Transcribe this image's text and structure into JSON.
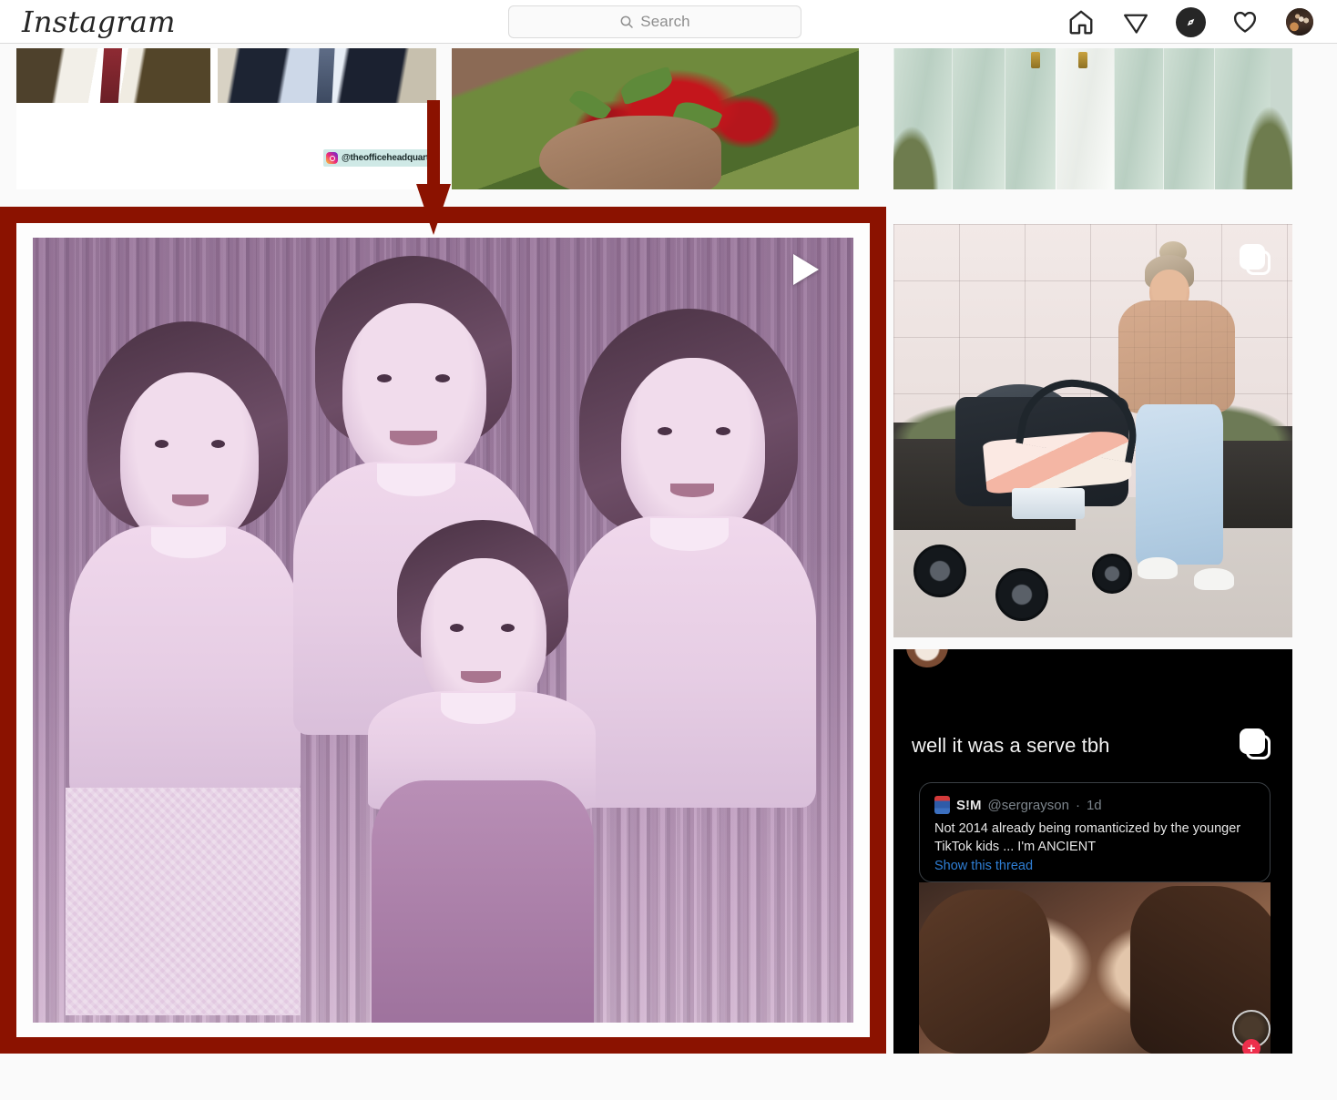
{
  "app": {
    "name": "Instagram",
    "logo_text": "Instagram",
    "background_color": "#fafafa"
  },
  "header": {
    "logo": "Instagram",
    "search": {
      "placeholder": "Search",
      "value": "",
      "icon": "search-icon"
    },
    "nav": [
      {
        "name": "home-icon",
        "label": "Home",
        "state": "outline"
      },
      {
        "name": "direct-messages-icon",
        "label": "Messages",
        "state": "outline"
      },
      {
        "name": "explore-compass-icon",
        "label": "Explore",
        "state": "filled"
      },
      {
        "name": "activity-heart-icon",
        "label": "Activity",
        "state": "outline"
      },
      {
        "name": "profile-avatar",
        "label": "Profile",
        "state": "image"
      }
    ]
  },
  "annotation": {
    "arrow": {
      "name": "red-down-arrow",
      "color": "#8b1200",
      "direction": "down",
      "points_to": "highlighted-video-post"
    },
    "highlight_box": {
      "name": "red-highlight-border",
      "color": "#8b1200",
      "border_width_px": 18,
      "target": "explore-video-post"
    }
  },
  "grid": {
    "posts": [
      {
        "id": "office-post",
        "name": "post-the-office",
        "kind": "image",
        "watermark": {
          "text": "@theofficeheadquarters",
          "icon": "instagram-glyph-icon",
          "background_color": "#cfe9e6"
        }
      },
      {
        "id": "strawberry-post",
        "name": "post-strawberries",
        "kind": "image",
        "description": "hand holding fresh strawberries"
      },
      {
        "id": "bridesmaid-post",
        "name": "post-bridesmaid-dresses",
        "kind": "image",
        "description": "mint green bridesmaid dresses"
      },
      {
        "id": "video-post",
        "name": "post-vintage-video",
        "kind": "video",
        "highlighted": true,
        "play_icon": "play-triangle-icon",
        "description": "purple tinted vintage clip with three girls and a boy"
      },
      {
        "id": "stroller-post",
        "name": "post-mom-with-stroller",
        "kind": "carousel",
        "carousel_icon": "carousel-stacked-squares-icon",
        "description": "woman in tan puffer jacket with baby stroller"
      },
      {
        "id": "tweet-post",
        "name": "post-tweet-screenshot",
        "kind": "carousel",
        "carousel_icon": "carousel-stacked-squares-icon",
        "caption": "well it was a serve tbh",
        "tweet": {
          "display_name": "S!M",
          "handle": "@sergrayson",
          "timestamp": "1d",
          "separator": "·",
          "body": "Not 2014 already being romanticized by the younger TikTok kids ... I'm ANCIENT",
          "thread_link": "Show this thread"
        },
        "story_badge": "+"
      }
    ]
  }
}
